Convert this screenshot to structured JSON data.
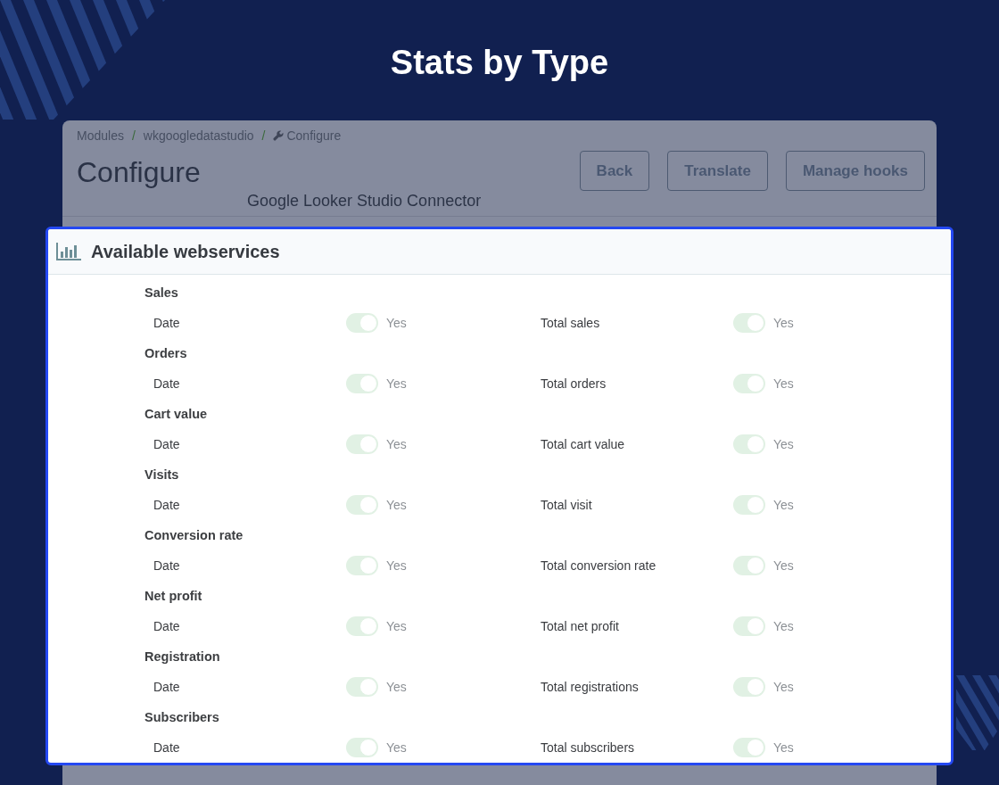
{
  "title": "Stats by Type",
  "page": {
    "breadcrumb": [
      {
        "kind": "link",
        "text": "Modules"
      },
      {
        "kind": "separator",
        "text": "/"
      },
      {
        "kind": "link",
        "text": "wkgoogledatastudio"
      },
      {
        "kind": "separator",
        "text": "/"
      },
      {
        "kind": "current",
        "text": "Configure"
      }
    ],
    "heading": "Configure",
    "subtitle": "Google Looker Studio Connector",
    "buttons": [
      "Back",
      "Translate",
      "Manage hooks"
    ]
  },
  "panel": {
    "title": "Available webservices",
    "groups": [
      {
        "name": "Sales",
        "fields": [
          {
            "label": "Date",
            "on": true,
            "disabled": true,
            "value_label": "Yes"
          },
          {
            "label": "Total sales",
            "on": true,
            "disabled": true,
            "value_label": "Yes"
          }
        ]
      },
      {
        "name": "Orders",
        "fields": [
          {
            "label": "Date",
            "on": true,
            "disabled": true,
            "value_label": "Yes"
          },
          {
            "label": "Total orders",
            "on": true,
            "disabled": true,
            "value_label": "Yes"
          }
        ]
      },
      {
        "name": "Cart value",
        "fields": [
          {
            "label": "Date",
            "on": true,
            "disabled": true,
            "value_label": "Yes"
          },
          {
            "label": "Total cart value",
            "on": true,
            "disabled": true,
            "value_label": "Yes"
          }
        ]
      },
      {
        "name": "Visits",
        "fields": [
          {
            "label": "Date",
            "on": true,
            "disabled": true,
            "value_label": "Yes"
          },
          {
            "label": "Total visit",
            "on": true,
            "disabled": true,
            "value_label": "Yes"
          }
        ]
      },
      {
        "name": "Conversion rate",
        "fields": [
          {
            "label": "Date",
            "on": true,
            "disabled": true,
            "value_label": "Yes"
          },
          {
            "label": "Total conversion rate",
            "on": true,
            "disabled": true,
            "value_label": "Yes"
          }
        ]
      },
      {
        "name": "Net profit",
        "fields": [
          {
            "label": "Date",
            "on": true,
            "disabled": true,
            "value_label": "Yes"
          },
          {
            "label": "Total net profit",
            "on": true,
            "disabled": true,
            "value_label": "Yes"
          }
        ]
      },
      {
        "name": "Registration",
        "fields": [
          {
            "label": "Date",
            "on": true,
            "disabled": true,
            "value_label": "Yes"
          },
          {
            "label": "Total registrations",
            "on": true,
            "disabled": true,
            "value_label": "Yes"
          }
        ]
      },
      {
        "name": "Subscribers",
        "fields": [
          {
            "label": "Date",
            "on": true,
            "disabled": true,
            "value_label": "Yes"
          },
          {
            "label": "Total subscribers",
            "on": true,
            "disabled": true,
            "value_label": "Yes"
          }
        ]
      }
    ]
  }
}
